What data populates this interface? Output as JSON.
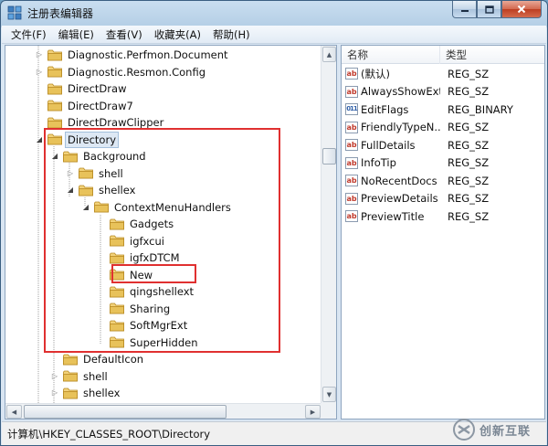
{
  "window": {
    "title": "注册表编辑器",
    "controls": [
      "minimize",
      "maximize",
      "close"
    ]
  },
  "menu": [
    "文件(F)",
    "编辑(E)",
    "查看(V)",
    "收藏夹(A)",
    "帮助(H)"
  ],
  "tree": [
    {
      "label": "Diagnostic.Perfmon.Document",
      "depth": 0,
      "expander": "collapsed"
    },
    {
      "label": "Diagnostic.Resmon.Config",
      "depth": 0,
      "expander": "collapsed"
    },
    {
      "label": "DirectDraw",
      "depth": 0,
      "expander": "none"
    },
    {
      "label": "DirectDraw7",
      "depth": 0,
      "expander": "none"
    },
    {
      "label": "DirectDrawClipper",
      "depth": 0,
      "expander": "none"
    },
    {
      "label": "Directory",
      "depth": 0,
      "expander": "expanded",
      "selected": true
    },
    {
      "label": "Background",
      "depth": 1,
      "expander": "expanded"
    },
    {
      "label": "shell",
      "depth": 2,
      "expander": "collapsed"
    },
    {
      "label": "shellex",
      "depth": 2,
      "expander": "expanded"
    },
    {
      "label": "ContextMenuHandlers",
      "depth": 3,
      "expander": "expanded"
    },
    {
      "label": "Gadgets",
      "depth": 4,
      "expander": "none"
    },
    {
      "label": "igfxcui",
      "depth": 4,
      "expander": "none"
    },
    {
      "label": "igfxDTCM",
      "depth": 4,
      "expander": "none"
    },
    {
      "label": "New",
      "depth": 4,
      "expander": "none",
      "highlighted": true
    },
    {
      "label": "qingshellext",
      "depth": 4,
      "expander": "none"
    },
    {
      "label": "Sharing",
      "depth": 4,
      "expander": "none"
    },
    {
      "label": "SoftMgrExt",
      "depth": 4,
      "expander": "none"
    },
    {
      "label": "SuperHidden",
      "depth": 4,
      "expander": "none"
    },
    {
      "label": "DefaultIcon",
      "depth": 1,
      "expander": "none"
    },
    {
      "label": "shell",
      "depth": 1,
      "expander": "collapsed"
    },
    {
      "label": "shellex",
      "depth": 1,
      "expander": "collapsed"
    }
  ],
  "values": {
    "headers": {
      "name": "名称",
      "type": "类型"
    },
    "rows": [
      {
        "name": "(默认)",
        "type": "REG_SZ",
        "icon": "ab-string-icon"
      },
      {
        "name": "AlwaysShowExt",
        "type": "REG_SZ",
        "icon": "ab-string-icon"
      },
      {
        "name": "EditFlags",
        "type": "REG_BINARY",
        "icon": "binary-value-icon"
      },
      {
        "name": "FriendlyTypeN...",
        "type": "REG_SZ",
        "icon": "ab-string-icon"
      },
      {
        "name": "FullDetails",
        "type": "REG_SZ",
        "icon": "ab-string-icon"
      },
      {
        "name": "InfoTip",
        "type": "REG_SZ",
        "icon": "ab-string-icon"
      },
      {
        "name": "NoRecentDocs",
        "type": "REG_SZ",
        "icon": "ab-string-icon"
      },
      {
        "name": "PreviewDetails",
        "type": "REG_SZ",
        "icon": "ab-string-icon"
      },
      {
        "name": "PreviewTitle",
        "type": "REG_SZ",
        "icon": "ab-string-icon"
      }
    ]
  },
  "status": {
    "path": "计算机\\HKEY_CLASSES_ROOT\\Directory"
  },
  "watermark": {
    "text": "创新互联"
  },
  "colors": {
    "highlight_box": "#e03030",
    "selection": "#dde8f4",
    "folder": "#e8c25a"
  }
}
